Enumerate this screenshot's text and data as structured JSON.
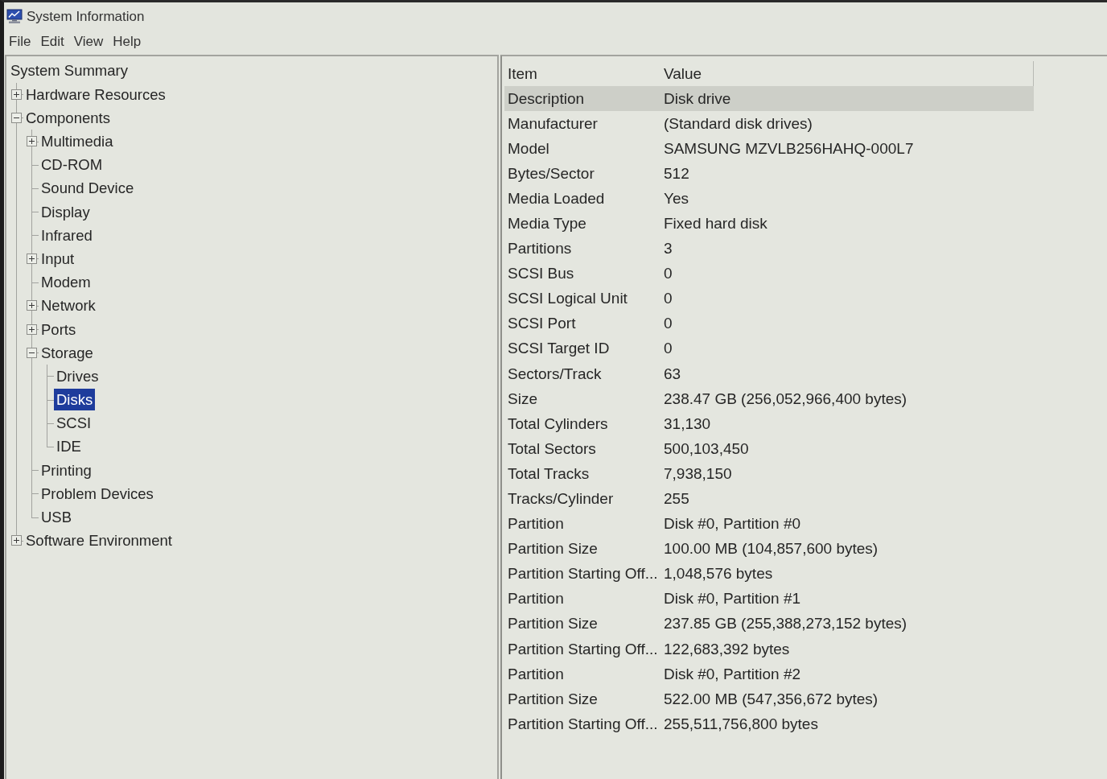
{
  "window": {
    "title": "System Information"
  },
  "menu": [
    "File",
    "Edit",
    "View",
    "Help"
  ],
  "tree": [
    {
      "label": "System Summary",
      "selected": false,
      "children": [
        {
          "label": "Hardware Resources",
          "expanded": false,
          "selected": false
        },
        {
          "label": "Components",
          "expanded": true,
          "selected": false,
          "children": [
            {
              "label": "Multimedia",
              "expanded": false,
              "selected": false
            },
            {
              "label": "CD-ROM",
              "selected": false
            },
            {
              "label": "Sound Device",
              "selected": false
            },
            {
              "label": "Display",
              "selected": false
            },
            {
              "label": "Infrared",
              "selected": false
            },
            {
              "label": "Input",
              "expanded": false,
              "selected": false
            },
            {
              "label": "Modem",
              "selected": false
            },
            {
              "label": "Network",
              "expanded": false,
              "selected": false
            },
            {
              "label": "Ports",
              "expanded": false,
              "selected": false
            },
            {
              "label": "Storage",
              "expanded": true,
              "selected": false,
              "children": [
                {
                  "label": "Drives",
                  "selected": false
                },
                {
                  "label": "Disks",
                  "selected": true
                },
                {
                  "label": "SCSI",
                  "selected": false
                },
                {
                  "label": "IDE",
                  "selected": false
                }
              ]
            },
            {
              "label": "Printing",
              "selected": false
            },
            {
              "label": "Problem Devices",
              "selected": false
            },
            {
              "label": "USB",
              "selected": false
            }
          ]
        },
        {
          "label": "Software Environment",
          "expanded": false,
          "selected": false
        }
      ]
    }
  ],
  "table": {
    "columns": [
      "Item",
      "Value"
    ],
    "rows": [
      {
        "item": "Description",
        "value": "Disk drive",
        "selected": true
      },
      {
        "item": "Manufacturer",
        "value": "(Standard disk drives)",
        "selected": false
      },
      {
        "item": "Model",
        "value": "SAMSUNG MZVLB256HAHQ-000L7",
        "selected": false
      },
      {
        "item": "Bytes/Sector",
        "value": "512",
        "selected": false
      },
      {
        "item": "Media Loaded",
        "value": "Yes",
        "selected": false
      },
      {
        "item": "Media Type",
        "value": "Fixed hard disk",
        "selected": false
      },
      {
        "item": "Partitions",
        "value": "3",
        "selected": false
      },
      {
        "item": "SCSI Bus",
        "value": "0",
        "selected": false
      },
      {
        "item": "SCSI Logical Unit",
        "value": "0",
        "selected": false
      },
      {
        "item": "SCSI Port",
        "value": "0",
        "selected": false
      },
      {
        "item": "SCSI Target ID",
        "value": "0",
        "selected": false
      },
      {
        "item": "Sectors/Track",
        "value": "63",
        "selected": false
      },
      {
        "item": "Size",
        "value": "238.47 GB (256,052,966,400 bytes)",
        "selected": false
      },
      {
        "item": "Total Cylinders",
        "value": "31,130",
        "selected": false
      },
      {
        "item": "Total Sectors",
        "value": "500,103,450",
        "selected": false
      },
      {
        "item": "Total Tracks",
        "value": "7,938,150",
        "selected": false
      },
      {
        "item": "Tracks/Cylinder",
        "value": "255",
        "selected": false
      },
      {
        "item": "Partition",
        "value": "Disk #0, Partition #0",
        "selected": false
      },
      {
        "item": "Partition Size",
        "value": "100.00 MB (104,857,600 bytes)",
        "selected": false
      },
      {
        "item": "Partition Starting Off...",
        "value": "1,048,576 bytes",
        "selected": false
      },
      {
        "item": "Partition",
        "value": "Disk #0, Partition #1",
        "selected": false
      },
      {
        "item": "Partition Size",
        "value": "237.85 GB (255,388,273,152 bytes)",
        "selected": false
      },
      {
        "item": "Partition Starting Off...",
        "value": "122,683,392 bytes",
        "selected": false
      },
      {
        "item": "Partition",
        "value": "Disk #0, Partition #2",
        "selected": false
      },
      {
        "item": "Partition Size",
        "value": "522.00 MB (547,356,672 bytes)",
        "selected": false
      },
      {
        "item": "Partition Starting Off...",
        "value": "255,511,756,800 bytes",
        "selected": false
      }
    ]
  }
}
